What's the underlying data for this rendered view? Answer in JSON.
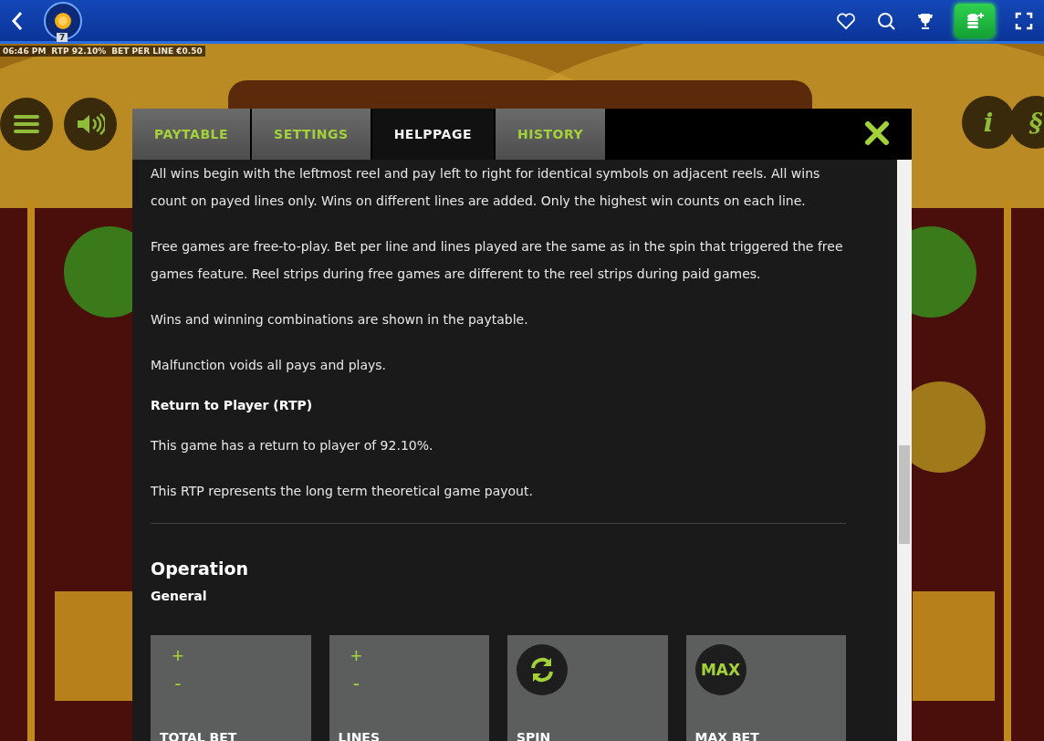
{
  "top_bar": {
    "badge": "7"
  },
  "info_bar": [
    "06:46 PM",
    "RTP 92.10%",
    "BET PER LINE €0.50"
  ],
  "game_buttons_right": [
    "i",
    "§"
  ],
  "tabs": [
    {
      "label": "PAYTABLE",
      "selected": false
    },
    {
      "label": "SETTINGS",
      "selected": false
    },
    {
      "label": "HELPPAGE",
      "selected": true
    },
    {
      "label": "HISTORY",
      "selected": false
    }
  ],
  "content": [
    {
      "kind": "p",
      "text": "All wins begin with the leftmost reel and pay left to right for identical symbols on adjacent reels. All wins count on payed lines only. Wins on different lines are added. Only the highest win counts on each line."
    },
    {
      "kind": "p",
      "text": "Free games are free-to-play. Bet per line and lines played are the same as in the spin that triggered the free games feature. Reel strips during free games are different to the reel strips during paid games."
    },
    {
      "kind": "p",
      "text": "Wins and winning combinations are shown in the paytable."
    },
    {
      "kind": "p",
      "text": "Malfunction voids all pays and plays."
    },
    {
      "kind": "h3",
      "text": "Return to Player (RTP)"
    },
    {
      "kind": "p",
      "text": "This game has a return to player of 92.10%."
    },
    {
      "kind": "p",
      "text": "This RTP represents the long term theoretical game payout."
    },
    {
      "kind": "rule"
    },
    {
      "kind": "h2",
      "text": "Operation"
    },
    {
      "kind": "h3",
      "text": "General"
    }
  ],
  "cards": [
    {
      "kind": "plusminus",
      "plus": "+",
      "minus": "-",
      "label": "TOTAL BET"
    },
    {
      "kind": "plusminus",
      "plus": "+",
      "minus": "-",
      "label": "LINES"
    },
    {
      "kind": "spin",
      "label": "SPIN"
    },
    {
      "kind": "max",
      "badge": "MAX",
      "label": "MAX BET"
    }
  ]
}
